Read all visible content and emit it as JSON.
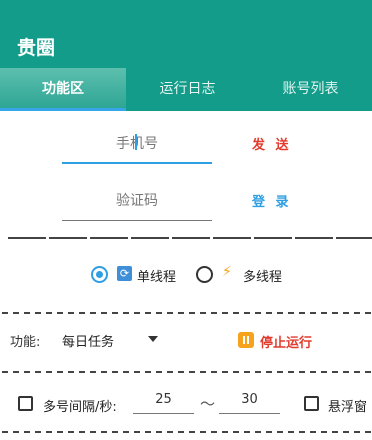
{
  "app": {
    "title": "贵圈"
  },
  "tabs": [
    {
      "label": "功能区",
      "active": true
    },
    {
      "label": "运行日志",
      "active": false
    },
    {
      "label": "账号列表",
      "active": false
    }
  ],
  "login": {
    "phone_placeholder": "手机号",
    "send_label": "发 送",
    "code_placeholder": "验证码",
    "login_label": "登 录"
  },
  "thread_mode": {
    "single_label": "单线程",
    "multi_label": "多线程",
    "selected": "single"
  },
  "function": {
    "label": "功能:",
    "selected": "每日任务",
    "stop_label": "停止运行"
  },
  "options": {
    "interval_label": "多号间隔/秒:",
    "interval_min": "25",
    "tilde": "～",
    "interval_max": "30",
    "float_label": "悬浮窗"
  },
  "colors": {
    "primary": "#139c8a",
    "accent_blue": "#2f9fe4",
    "danger_red": "#e23b2e",
    "stop_orange": "#f6a21c"
  }
}
